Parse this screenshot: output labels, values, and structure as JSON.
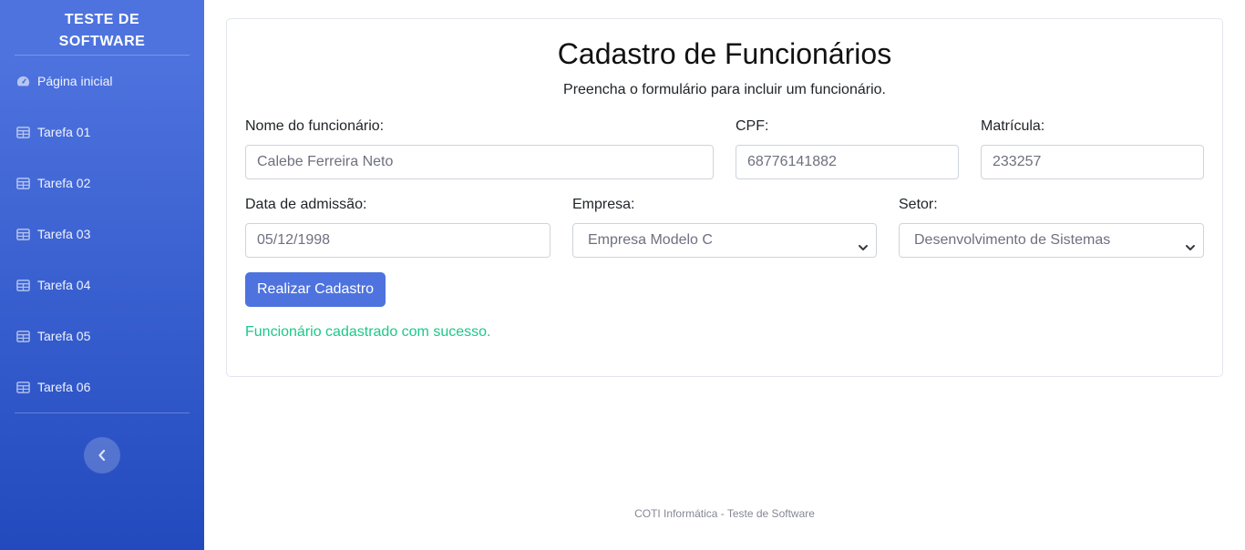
{
  "sidebar": {
    "brand_line1": "TESTE DE",
    "brand_line2": "SOFTWARE",
    "items": [
      {
        "label": "Página inicial",
        "icon": "dashboard-gauge-icon"
      },
      {
        "label": "Tarefa 01",
        "icon": "table-icon"
      },
      {
        "label": "Tarefa 02",
        "icon": "table-icon"
      },
      {
        "label": "Tarefa 03",
        "icon": "table-icon"
      },
      {
        "label": "Tarefa 04",
        "icon": "table-icon"
      },
      {
        "label": "Tarefa 05",
        "icon": "table-icon"
      },
      {
        "label": "Tarefa 06",
        "icon": "table-icon"
      }
    ],
    "toggle_icon": "chevron-left-icon"
  },
  "form": {
    "title": "Cadastro de Funcionários",
    "subtitle": "Preencha o formulário para incluir um funcionário.",
    "nome_label": "Nome do funcionário:",
    "nome_value": "Calebe Ferreira Neto",
    "cpf_label": "CPF:",
    "cpf_value": "68776141882",
    "matricula_label": "Matrícula:",
    "matricula_value": "233257",
    "admissao_label": "Data de admissão:",
    "admissao_value": "05/12/1998",
    "empresa_label": "Empresa:",
    "empresa_value": "Empresa Modelo C",
    "setor_label": "Setor:",
    "setor_value": "Desenvolvimento de Sistemas",
    "submit_label": "Realizar Cadastro",
    "success_message": "Funcionário cadastrado com sucesso."
  },
  "footer": {
    "text": "COTI Informática - Teste de Software"
  },
  "colors": {
    "primary": "#4e73df",
    "sidebar_gradient_end": "#224abe",
    "success": "#1cc88a"
  }
}
